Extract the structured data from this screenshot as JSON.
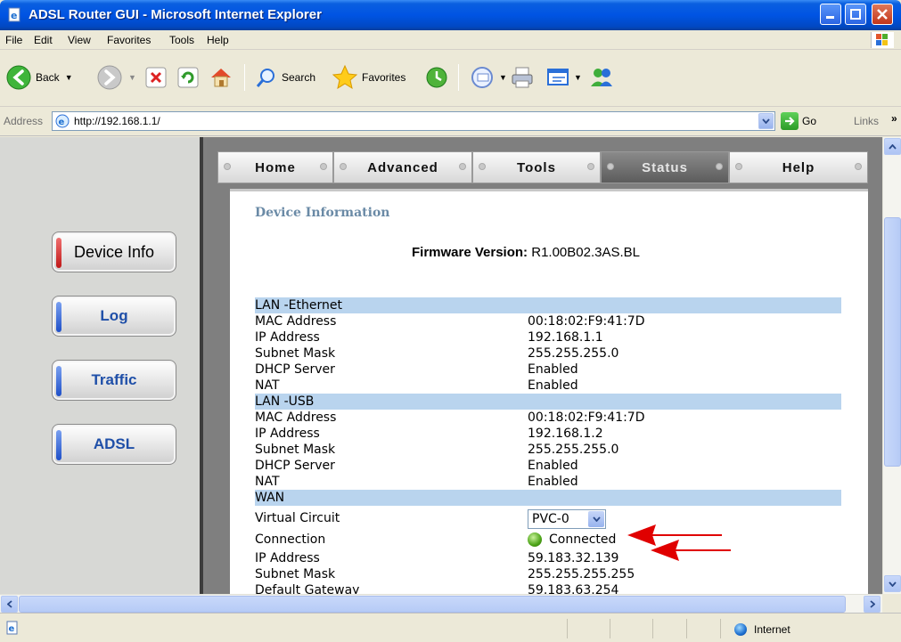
{
  "window": {
    "title": "ADSL Router GUI - Microsoft Internet Explorer"
  },
  "menu": [
    "File",
    "Edit",
    "View",
    "Favorites",
    "Tools",
    "Help"
  ],
  "toolbar": {
    "back": "Back",
    "search": "Search",
    "favorites": "Favorites"
  },
  "address": {
    "label": "Address",
    "url": "http://192.168.1.1/",
    "go": "Go",
    "links": "Links",
    "more": "»"
  },
  "sidebar": {
    "items": [
      "Device Info",
      "Log",
      "Traffic",
      "ADSL"
    ],
    "active": "Device Info"
  },
  "nav": {
    "tabs": [
      "Home",
      "Advanced",
      "Tools",
      "Status",
      "Help"
    ],
    "active": "Status"
  },
  "page": {
    "section_title": "Device Information",
    "firmware_label": "Firmware Version:",
    "firmware_value": "R1.00B02.3AS.BL",
    "lan_ethernet": {
      "header": "LAN -Ethernet",
      "rows": [
        {
          "k": "MAC Address",
          "v": "00:18:02:F9:41:7D"
        },
        {
          "k": "IP Address",
          "v": "192.168.1.1"
        },
        {
          "k": "Subnet Mask",
          "v": "255.255.255.0"
        },
        {
          "k": "DHCP Server",
          "v": "Enabled"
        },
        {
          "k": "NAT",
          "v": "Enabled"
        }
      ]
    },
    "lan_usb": {
      "header": "LAN -USB",
      "rows": [
        {
          "k": "MAC Address",
          "v": "00:18:02:F9:41:7D"
        },
        {
          "k": "IP Address",
          "v": "192.168.1.2"
        },
        {
          "k": "Subnet Mask",
          "v": "255.255.255.0"
        },
        {
          "k": "DHCP Server",
          "v": "Enabled"
        },
        {
          "k": "NAT",
          "v": "Enabled"
        }
      ]
    },
    "wan": {
      "header": "WAN",
      "virtual_circuit_label": "Virtual Circuit",
      "virtual_circuit_value": "PVC-0",
      "connection_label": "Connection",
      "connection_value": "Connected",
      "rows": [
        {
          "k": "IP Address",
          "v": "59.183.32.139"
        },
        {
          "k": "Subnet Mask",
          "v": "255.255.255.255"
        },
        {
          "k": "Default Gateway",
          "v": "59.183.63.254"
        }
      ]
    }
  },
  "statusbar": {
    "zone": "Internet"
  },
  "colors": {
    "annotation_arrow": "#e00000",
    "status_connected": "#4ca317",
    "header_row": "#b9d4ee"
  }
}
